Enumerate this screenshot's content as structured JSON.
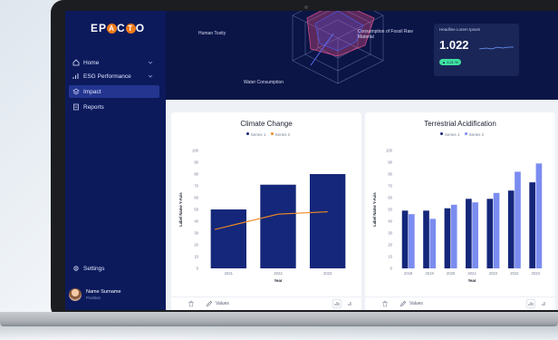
{
  "app": {
    "logo": {
      "pre": "EP",
      "a": "A",
      "mid": "C",
      "o": "T",
      "post": "O"
    }
  },
  "sidebar": {
    "items": [
      {
        "label": "Home",
        "icon": "home-icon",
        "expandable": true
      },
      {
        "label": "ESG Performance",
        "icon": "chart-icon",
        "expandable": true
      },
      {
        "label": "Impact",
        "icon": "layers-icon",
        "expandable": false,
        "active": true
      },
      {
        "label": "Reports",
        "icon": "document-icon",
        "expandable": false
      }
    ],
    "settings_label": "Settings",
    "user": {
      "name": "Name Surname",
      "role": "Position"
    }
  },
  "radar": {
    "labels": {
      "human_toxicity": "Human Toxity",
      "fossil": "Consumption of Fossil Raw Material",
      "water": "Water Consumption"
    }
  },
  "kpi": {
    "title": "Headline Lorem Ipsum",
    "value": "1.022",
    "badge": "▲ 1.21 %"
  },
  "colors": {
    "sidebar": "#0c1a5c",
    "series1": "#15277a",
    "series2_line": "#f08a24",
    "series2_bar": "#7b8cf0"
  },
  "charts": {
    "climate": {
      "title": "Climate Change",
      "legend": [
        "Series 1",
        "Series 2"
      ],
      "ylabel": "Label Name Y-Axis",
      "xlabel": "Year",
      "footer_label": "Values"
    },
    "terrestrial": {
      "title": "Terrestrial Acidification",
      "legend": [
        "Series 1",
        "Series 2"
      ],
      "ylabel": "Label Name Y-Axis",
      "xlabel": "Year",
      "footer_label": "Values"
    }
  },
  "chart_data": [
    {
      "type": "bar",
      "title": "Climate Change",
      "categories": [
        "2021",
        "2022",
        "2023"
      ],
      "series": [
        {
          "name": "Series 1",
          "type": "bar",
          "values": [
            50,
            71,
            80
          ]
        },
        {
          "name": "Series 2",
          "type": "line",
          "values": [
            33,
            46,
            48
          ]
        }
      ],
      "yticks": [
        0,
        10,
        20,
        30,
        40,
        50,
        60,
        70,
        80,
        90,
        100
      ],
      "ylim": [
        0,
        100
      ],
      "xlabel": "Year",
      "ylabel": "Label Name Y-Axis",
      "legend": "top-center",
      "grid": false
    },
    {
      "type": "bar",
      "title": "Terrestrial Acidification",
      "categories": [
        "2018",
        "2019",
        "2020",
        "2021",
        "2022",
        "2022",
        "2023"
      ],
      "series": [
        {
          "name": "Series 1",
          "values": [
            49,
            49,
            51,
            59,
            59,
            66,
            73
          ]
        },
        {
          "name": "Series 2",
          "values": [
            46,
            42,
            54,
            56,
            64,
            82,
            89
          ]
        }
      ],
      "yticks": [
        0,
        10,
        20,
        30,
        40,
        50,
        60,
        70,
        80,
        90,
        100
      ],
      "ylim": [
        0,
        100
      ],
      "xlabel": "Year",
      "ylabel": "Label Name Y-Axis",
      "legend": "top-center",
      "grid": false
    }
  ]
}
